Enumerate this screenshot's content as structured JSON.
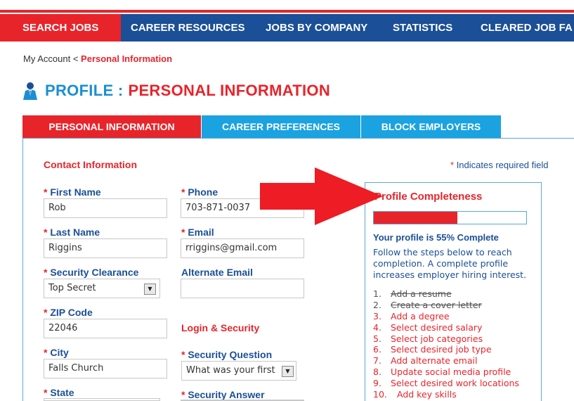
{
  "nav": {
    "items": [
      "SEARCH JOBS",
      "CAREER RESOURCES",
      "JOBS BY COMPANY",
      "STATISTICS",
      "CLEARED JOB FA"
    ]
  },
  "breadcrumb": {
    "root": "My Account",
    "sep": "<",
    "current": "Personal Information"
  },
  "title": {
    "part1": "PROFILE :",
    "part2": "PERSONAL INFORMATION"
  },
  "tabs": [
    "PERSONAL INFORMATION",
    "CAREER PREFERENCES",
    "BLOCK EMPLOYERS"
  ],
  "contact": {
    "heading": "Contact Information",
    "required_note": "Indicates required field",
    "star": "*",
    "first_name": {
      "label": "First Name",
      "value": "Rob"
    },
    "last_name": {
      "label": "Last Name",
      "value": "Riggins"
    },
    "clearance": {
      "label": "Security Clearance",
      "value": "Top Secret"
    },
    "zip": {
      "label": "ZIP Code",
      "value": "22046"
    },
    "city": {
      "label": "City",
      "value": "Falls Church"
    },
    "state": {
      "label": "State"
    },
    "phone": {
      "label": "Phone",
      "value": "703-871-0037"
    },
    "email": {
      "label": "Email",
      "value": "rriggins@gmail.com"
    },
    "alt_email": {
      "label": "Alternate Email",
      "value": ""
    }
  },
  "login": {
    "heading": "Login & Security",
    "question": {
      "label": "Security Question",
      "value": "What was your first"
    },
    "answer": {
      "label": "Security Answer"
    }
  },
  "completeness": {
    "title": "Profile Completeness",
    "percent": 55,
    "status": "Your profile is 55% Complete",
    "description": "Follow the steps below to reach completion. A complete profile increases employer hiring interest.",
    "steps": [
      {
        "num": "1.",
        "text": "Add a resume",
        "done": true
      },
      {
        "num": "2.",
        "text": "Create a cover letter",
        "done": true
      },
      {
        "num": "3.",
        "text": "Add a degree",
        "done": false
      },
      {
        "num": "4.",
        "text": "Select desired salary",
        "done": false
      },
      {
        "num": "5.",
        "text": "Select job categories",
        "done": false
      },
      {
        "num": "6.",
        "text": "Select desired job type",
        "done": false
      },
      {
        "num": "7.",
        "text": "Add alternate email",
        "done": false
      },
      {
        "num": "8.",
        "text": "Update social media profile",
        "done": false
      },
      {
        "num": "9.",
        "text": "Select desired work locations",
        "done": false
      },
      {
        "num": "10.",
        "text": "Add key skills",
        "done": false
      }
    ]
  },
  "colors": {
    "red": "#e8242b",
    "navy": "#1b4f97",
    "blue": "#1ba2e0",
    "arrow": "#ee1c24"
  },
  "icons": {
    "title": "person-icon",
    "select": "dropdown-arrow-icon",
    "callout": "red-arrow-icon"
  }
}
